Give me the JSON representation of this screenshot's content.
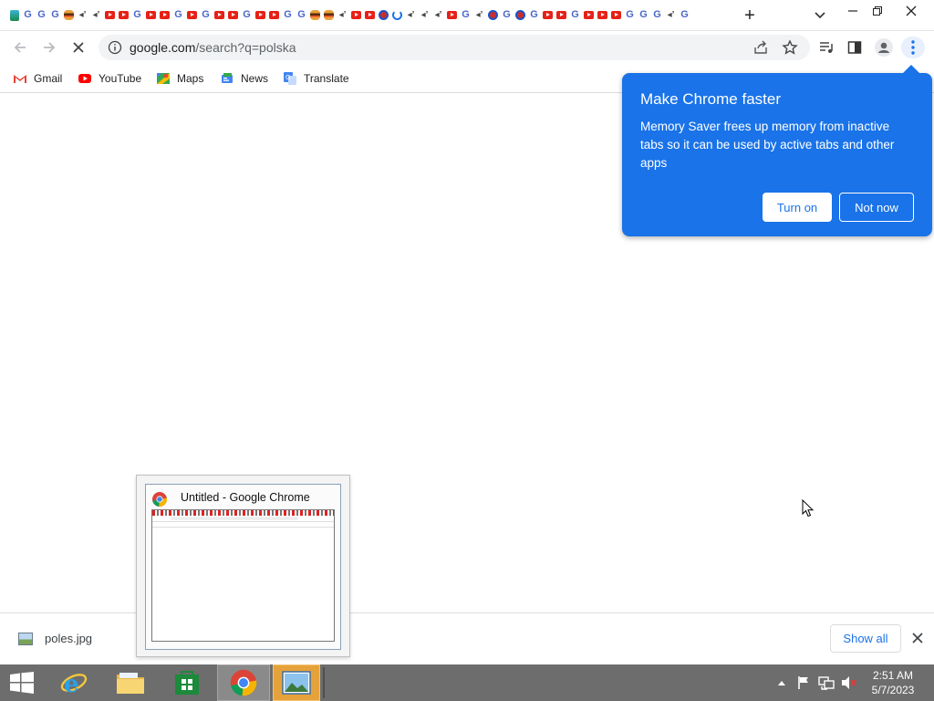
{
  "browser": {
    "tab_icons": [
      "file",
      "g",
      "g",
      "g",
      "burger",
      "spk",
      "spk",
      "yt",
      "yt",
      "g",
      "yt",
      "yt",
      "g",
      "yt",
      "g",
      "yt",
      "yt",
      "g",
      "yt",
      "yt",
      "g",
      "g",
      "burger",
      "burger",
      "spk",
      "yt",
      "yt",
      "red",
      "arc",
      "spk",
      "spk",
      "spk",
      "yt",
      "g",
      "spk",
      "red",
      "g",
      "red",
      "g",
      "yt",
      "yt",
      "g",
      "yt",
      "yt",
      "yt",
      "g",
      "g",
      "g",
      "spk",
      "g"
    ],
    "new_tab_label": "+",
    "address": {
      "host": "google.com",
      "path": "/search?q=polska"
    },
    "bookmarks": [
      {
        "label": "Gmail",
        "icon": "gmail-icon"
      },
      {
        "label": "YouTube",
        "icon": "youtube-icon"
      },
      {
        "label": "Maps",
        "icon": "maps-icon"
      },
      {
        "label": "News",
        "icon": "news-icon"
      },
      {
        "label": "Translate",
        "icon": "translate-icon"
      }
    ]
  },
  "bubble": {
    "title": "Make Chrome faster",
    "body": "Memory Saver frees up memory from inactive tabs so it can be used by active tabs and other apps",
    "turn_on": "Turn on",
    "not_now": "Not now"
  },
  "download": {
    "file": "poles.jpg",
    "show_all": "Show all"
  },
  "preview": {
    "title": "Untitled - Google Chrome"
  },
  "taskbar": {
    "time": "2:51 AM",
    "date": "5/7/2023"
  },
  "colors": {
    "accent": "#1a73e8",
    "taskbar": "#6d6d6d"
  }
}
